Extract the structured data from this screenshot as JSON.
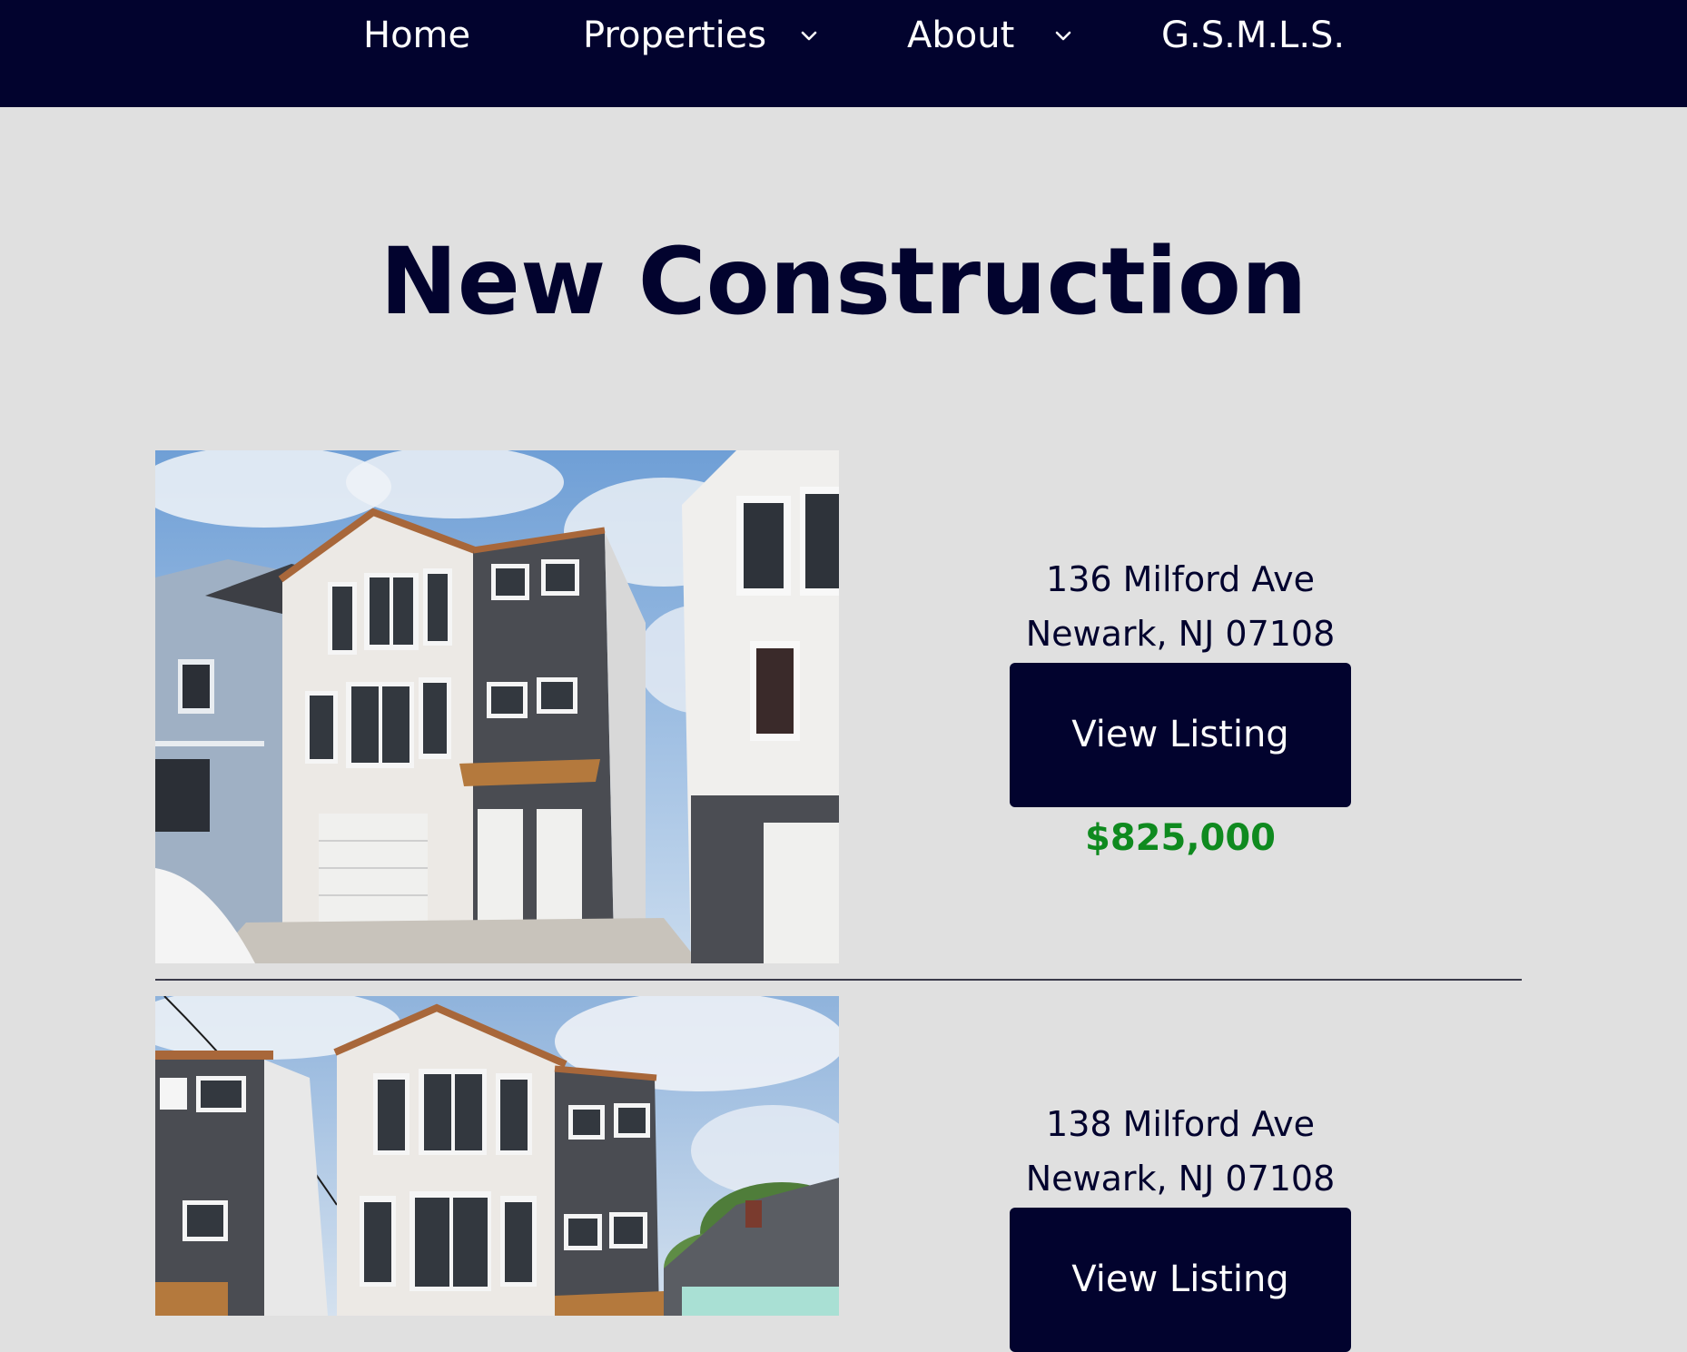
{
  "nav": {
    "items": [
      {
        "label": "Home",
        "has_dropdown": false
      },
      {
        "label": "Properties",
        "has_dropdown": true
      },
      {
        "label": "About",
        "has_dropdown": true
      },
      {
        "label": "G.S.M.L.S.",
        "has_dropdown": false
      }
    ],
    "dropdown_icon": "chevron-down-icon"
  },
  "page": {
    "title": "New Construction"
  },
  "listings": [
    {
      "address_line1": "136 Milford Ave",
      "address_line2": "Newark, NJ 07108",
      "button_label": "View Listing",
      "price": "$825,000"
    },
    {
      "address_line1": "138 Milford Ave",
      "address_line2": "Newark, NJ 07108",
      "button_label": "View Listing"
    }
  ],
  "colors": {
    "navy": "#02032e",
    "background": "#e0e0e0",
    "price": "#0f8a1f",
    "white": "#ffffff"
  }
}
